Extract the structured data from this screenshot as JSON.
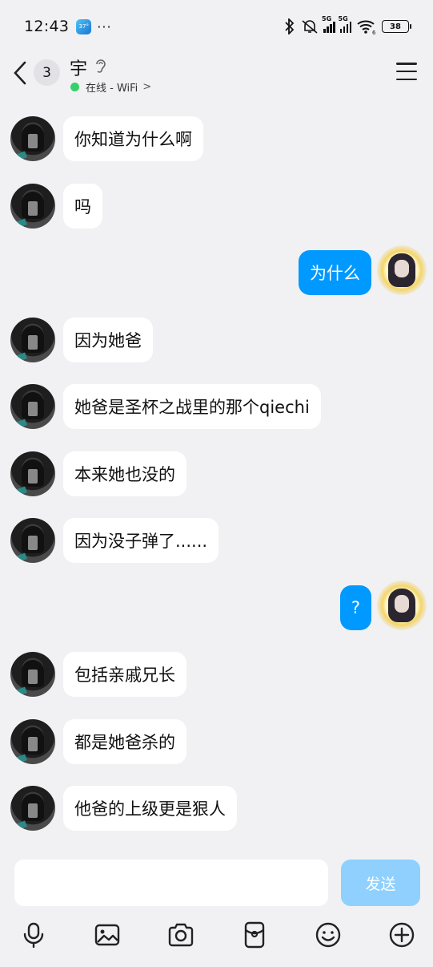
{
  "status_bar": {
    "time": "12:43",
    "app_badge": "37°",
    "more": "···",
    "network_1": "5G",
    "network_2": "5G",
    "wifi_sub": "6",
    "battery": "38"
  },
  "header": {
    "unread_count": "3",
    "contact_name": "宇",
    "presence_text": "在线 - WiFi",
    "presence_chevron": ">",
    "presence_color": "#35d06a"
  },
  "messages": [
    {
      "side": "in",
      "text": "你知道为什么啊"
    },
    {
      "side": "in",
      "text": "吗"
    },
    {
      "side": "out",
      "text": "为什么"
    },
    {
      "side": "in",
      "text": "因为她爸"
    },
    {
      "side": "in",
      "text": "她爸是圣杯之战里的那个qiechi"
    },
    {
      "side": "in",
      "text": "本来她也没的"
    },
    {
      "side": "in",
      "text": "因为没子弹了......"
    },
    {
      "side": "out",
      "text": "?"
    },
    {
      "side": "in",
      "text": "包括亲戚兄长"
    },
    {
      "side": "in",
      "text": "都是她爸杀的"
    },
    {
      "side": "in",
      "text": "他爸的上级更是狠人"
    }
  ],
  "composer": {
    "input_value": "",
    "send_label": "发送",
    "send_color": "#8fd0ff"
  },
  "toolbar": {
    "icons": [
      "microphone-icon",
      "image-icon",
      "camera-icon",
      "red-packet-icon",
      "emoji-icon",
      "plus-icon"
    ]
  },
  "colors": {
    "outgoing_bubble": "#0099ff",
    "incoming_bubble": "#ffffff",
    "background": "#f1f1f3"
  }
}
